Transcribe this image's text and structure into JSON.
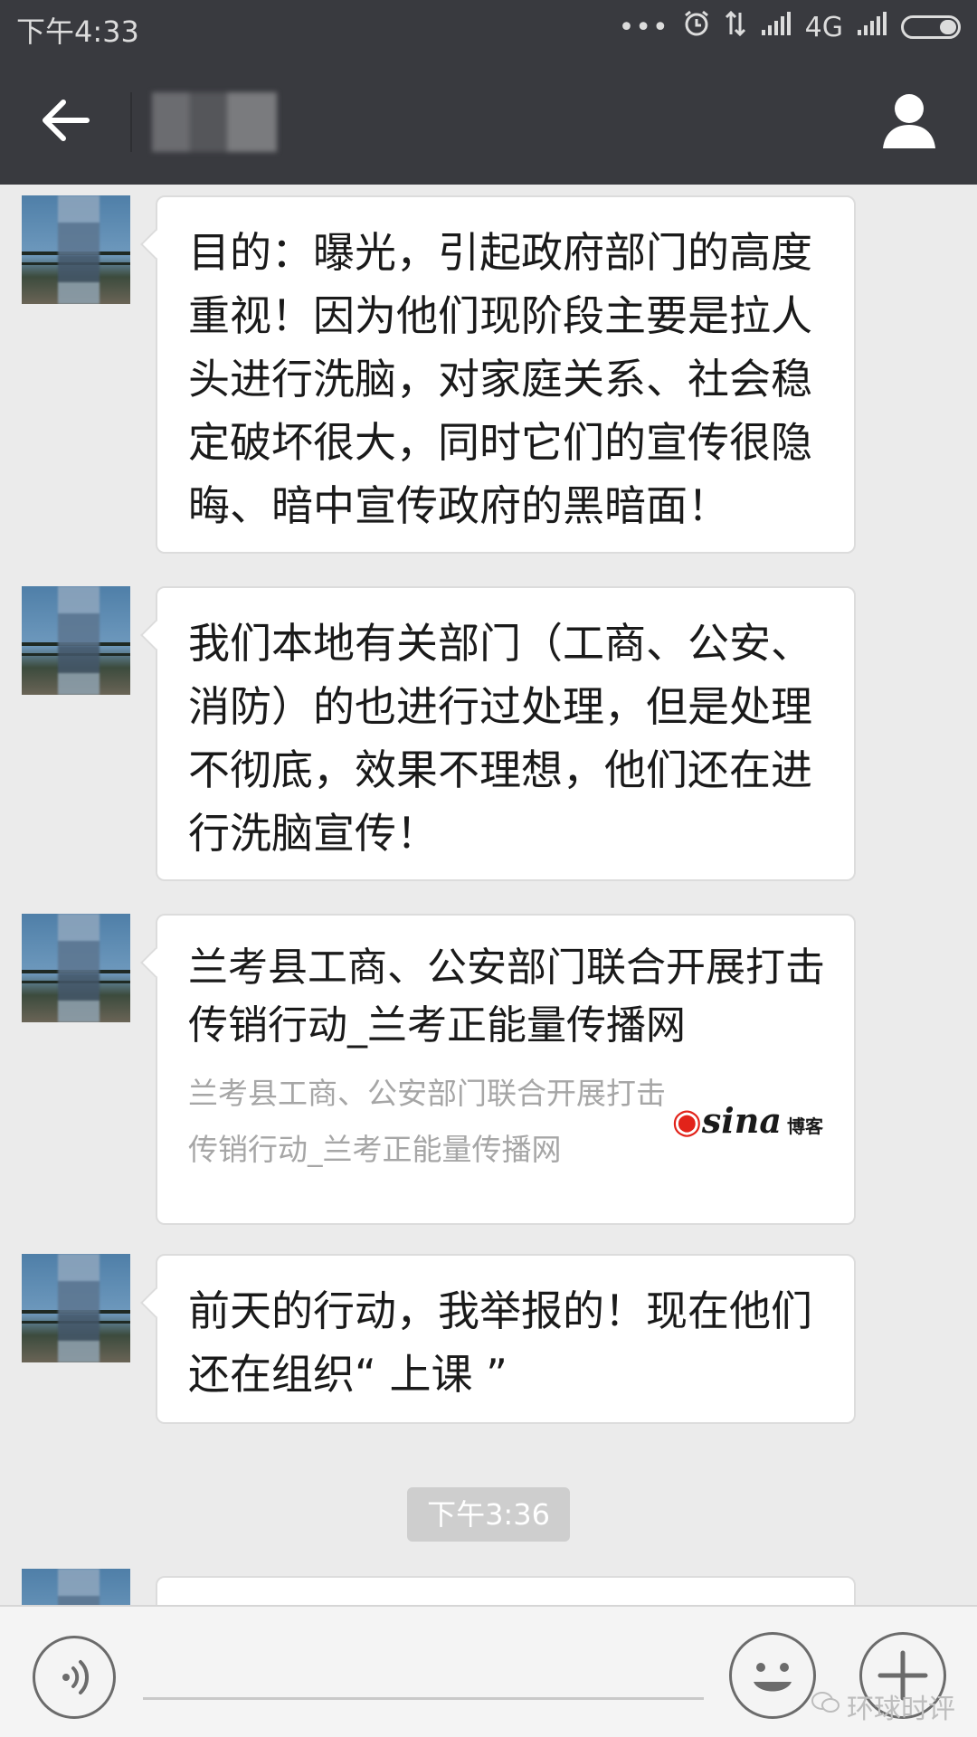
{
  "status_bar": {
    "time": "下午4:33",
    "dots": "•••",
    "network": "4G",
    "icons": [
      "alarm-icon",
      "data-arrows-icon",
      "signal-icon",
      "signal-icon",
      "battery-icon"
    ]
  },
  "title_bar": {
    "back_icon": "arrow-left-icon",
    "contact_icon": "person-icon"
  },
  "messages": [
    {
      "text": "目的：曝光，引起政府部门的高度重视！因为他们现阶段主要是拉人头进行洗脑，对家庭关系、社会稳定破坏很大，同时它们的宣传很隐晦、暗中宣传政府的黑暗面！"
    },
    {
      "text": "我们本地有关部门（工商、公安、消防）的也进行过处理，但是处理不彻底，效果不理想，他们还在进行洗脑宣传！"
    },
    {
      "link_title": "兰考县工商、公安部门联合开展打击传销行动_兰考正能量传播网",
      "link_desc": "兰考县工商、公安部门联合开展打击传销行动_兰考正能量传播网",
      "source_logo": "sina",
      "source_logo_suffix": "博客"
    },
    {
      "text": "前天的行动，我举报的！现在他们还在组织“ 上课 ”"
    }
  ],
  "time_divider": "下午3:36",
  "input_bar": {
    "icons": [
      "voice-icon",
      "emoji-icon",
      "plus-icon"
    ],
    "watermark": "环球时评"
  },
  "colors": {
    "header": "#393a3f",
    "chat_bg": "#ebebeb",
    "bubble": "#ffffff"
  }
}
